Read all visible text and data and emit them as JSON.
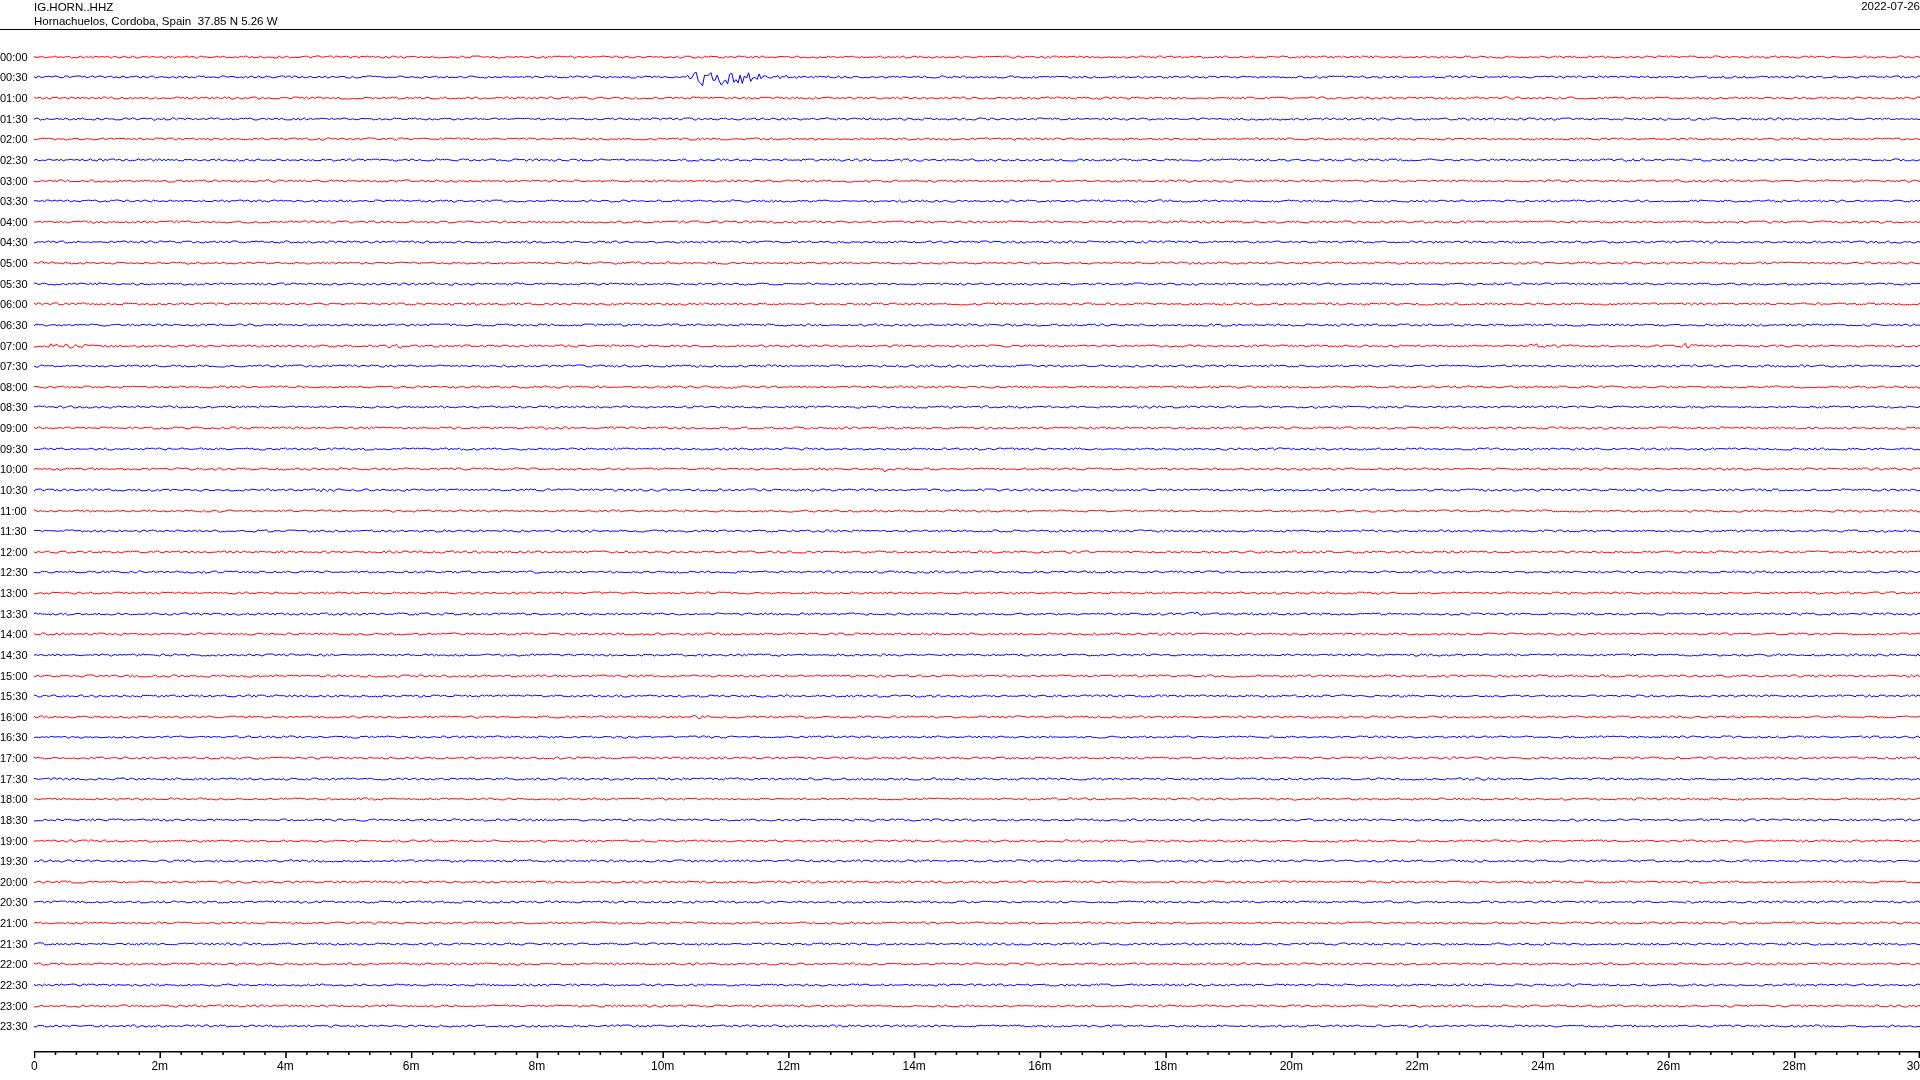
{
  "header": {
    "station": "IG.HORN..HHZ",
    "location": "Hornachuelos, Cordoba, Spain  37.85 N 5.26 W",
    "date": "2022-07-26"
  },
  "rows": [
    {
      "time": "00:00",
      "color": "#ff0000"
    },
    {
      "time": "00:30",
      "color": "#0000ff"
    },
    {
      "time": "01:00",
      "color": "#ff0000"
    },
    {
      "time": "01:30",
      "color": "#0000ff"
    },
    {
      "time": "02:00",
      "color": "#ff0000"
    },
    {
      "time": "02:30",
      "color": "#0000ff"
    },
    {
      "time": "03:00",
      "color": "#ff0000"
    },
    {
      "time": "03:30",
      "color": "#0000ff"
    },
    {
      "time": "04:00",
      "color": "#ff0000"
    },
    {
      "time": "04:30",
      "color": "#0000ff"
    },
    {
      "time": "05:00",
      "color": "#ff0000"
    },
    {
      "time": "05:30",
      "color": "#0000ff"
    },
    {
      "time": "06:00",
      "color": "#ff0000"
    },
    {
      "time": "06:30",
      "color": "#0000ff"
    },
    {
      "time": "07:00",
      "color": "#ff0000"
    },
    {
      "time": "07:30",
      "color": "#0000ff"
    },
    {
      "time": "08:00",
      "color": "#ff0000"
    },
    {
      "time": "08:30",
      "color": "#0000ff"
    },
    {
      "time": "09:00",
      "color": "#ff0000"
    },
    {
      "time": "09:30",
      "color": "#0000ff"
    },
    {
      "time": "10:00",
      "color": "#ff0000"
    },
    {
      "time": "10:30",
      "color": "#0000ff"
    },
    {
      "time": "11:00",
      "color": "#ff0000"
    },
    {
      "time": "11:30",
      "color": "#0000ff"
    },
    {
      "time": "12:00",
      "color": "#ff0000"
    },
    {
      "time": "12:30",
      "color": "#0000ff"
    },
    {
      "time": "13:00",
      "color": "#ff0000"
    },
    {
      "time": "13:30",
      "color": "#0000ff"
    },
    {
      "time": "14:00",
      "color": "#ff0000"
    },
    {
      "time": "14:30",
      "color": "#0000ff"
    },
    {
      "time": "15:00",
      "color": "#ff0000"
    },
    {
      "time": "15:30",
      "color": "#0000ff"
    },
    {
      "time": "16:00",
      "color": "#ff0000"
    },
    {
      "time": "16:30",
      "color": "#0000ff"
    },
    {
      "time": "17:00",
      "color": "#ff0000"
    },
    {
      "time": "17:30",
      "color": "#0000ff"
    },
    {
      "time": "18:00",
      "color": "#ff0000"
    },
    {
      "time": "18:30",
      "color": "#0000ff"
    },
    {
      "time": "19:00",
      "color": "#ff0000"
    },
    {
      "time": "19:30",
      "color": "#0000ff"
    },
    {
      "time": "20:00",
      "color": "#ff0000"
    },
    {
      "time": "20:30",
      "color": "#0000ff"
    },
    {
      "time": "21:00",
      "color": "#ff0000"
    },
    {
      "time": "21:30",
      "color": "#0000ff"
    },
    {
      "time": "22:00",
      "color": "#ff0000"
    },
    {
      "time": "22:30",
      "color": "#0000ff"
    },
    {
      "time": "23:00",
      "color": "#ff0000"
    },
    {
      "time": "23:30",
      "color": "#0000ff"
    }
  ],
  "x_axis": {
    "labels": [
      "0",
      "2m",
      "4m",
      "6m",
      "8m",
      "10m",
      "12m",
      "14m",
      "16m",
      "18m",
      "20m",
      "22m",
      "24m",
      "26m",
      "28m",
      "30"
    ]
  }
}
